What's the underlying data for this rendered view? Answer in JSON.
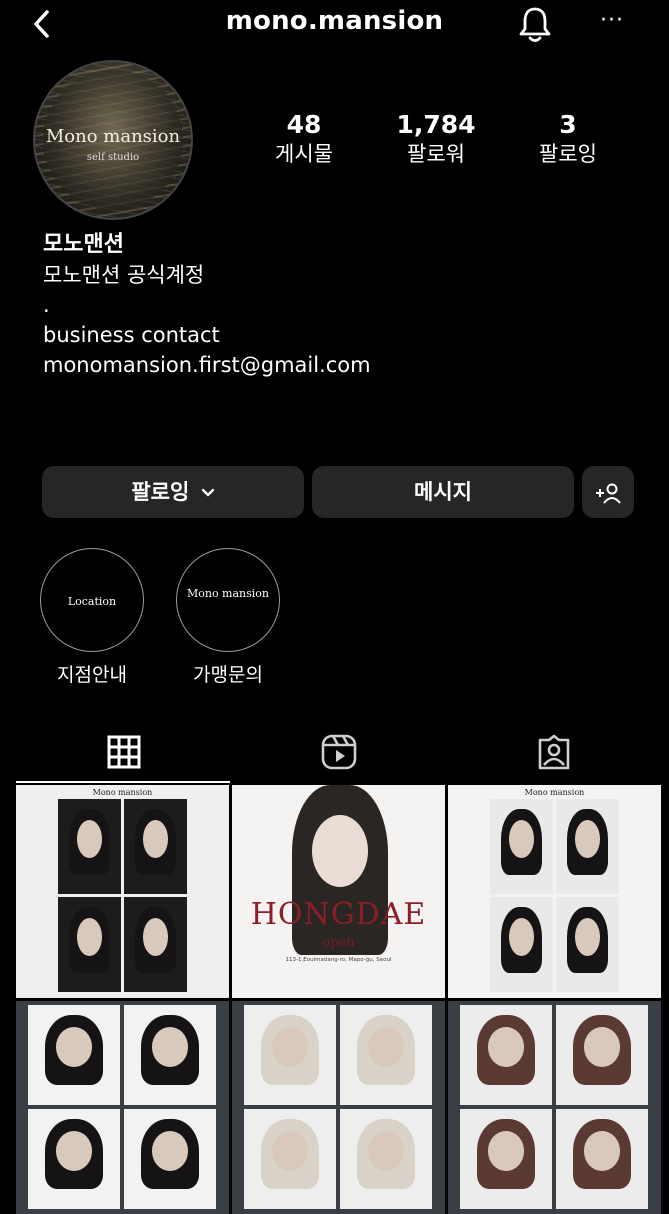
{
  "header": {
    "title": "mono.mansion",
    "more": "···"
  },
  "profile": {
    "avatar_brand": "Mono mansion",
    "avatar_sub": "self studio",
    "stats": [
      {
        "value": "48",
        "label": "게시물"
      },
      {
        "value": "1,784",
        "label": "팔로워"
      },
      {
        "value": "3",
        "label": "팔로잉"
      }
    ],
    "name": "모노맨션",
    "bio_lines": [
      "모노맨션 공식계정",
      ".",
      "business contact",
      "monomansion.first@gmail.com"
    ]
  },
  "buttons": {
    "follow": "팔로잉",
    "message": "메시지",
    "add_person": "+"
  },
  "highlights": [
    {
      "cover": "Location",
      "caption": "지점안내"
    },
    {
      "cover": "Mono mansion",
      "caption": "가맹문의"
    }
  ],
  "tabs": [
    "grid-icon",
    "reels-icon",
    "tagged-icon"
  ],
  "posts": {
    "p1_label": "Mono mansion",
    "p2_title": "HONGDAE",
    "p2_sub": "open",
    "p2_addr": "113-1,Eoulmadang-ro, Mapo-gu, Seoul",
    "p3_label": "Mono mansion"
  }
}
